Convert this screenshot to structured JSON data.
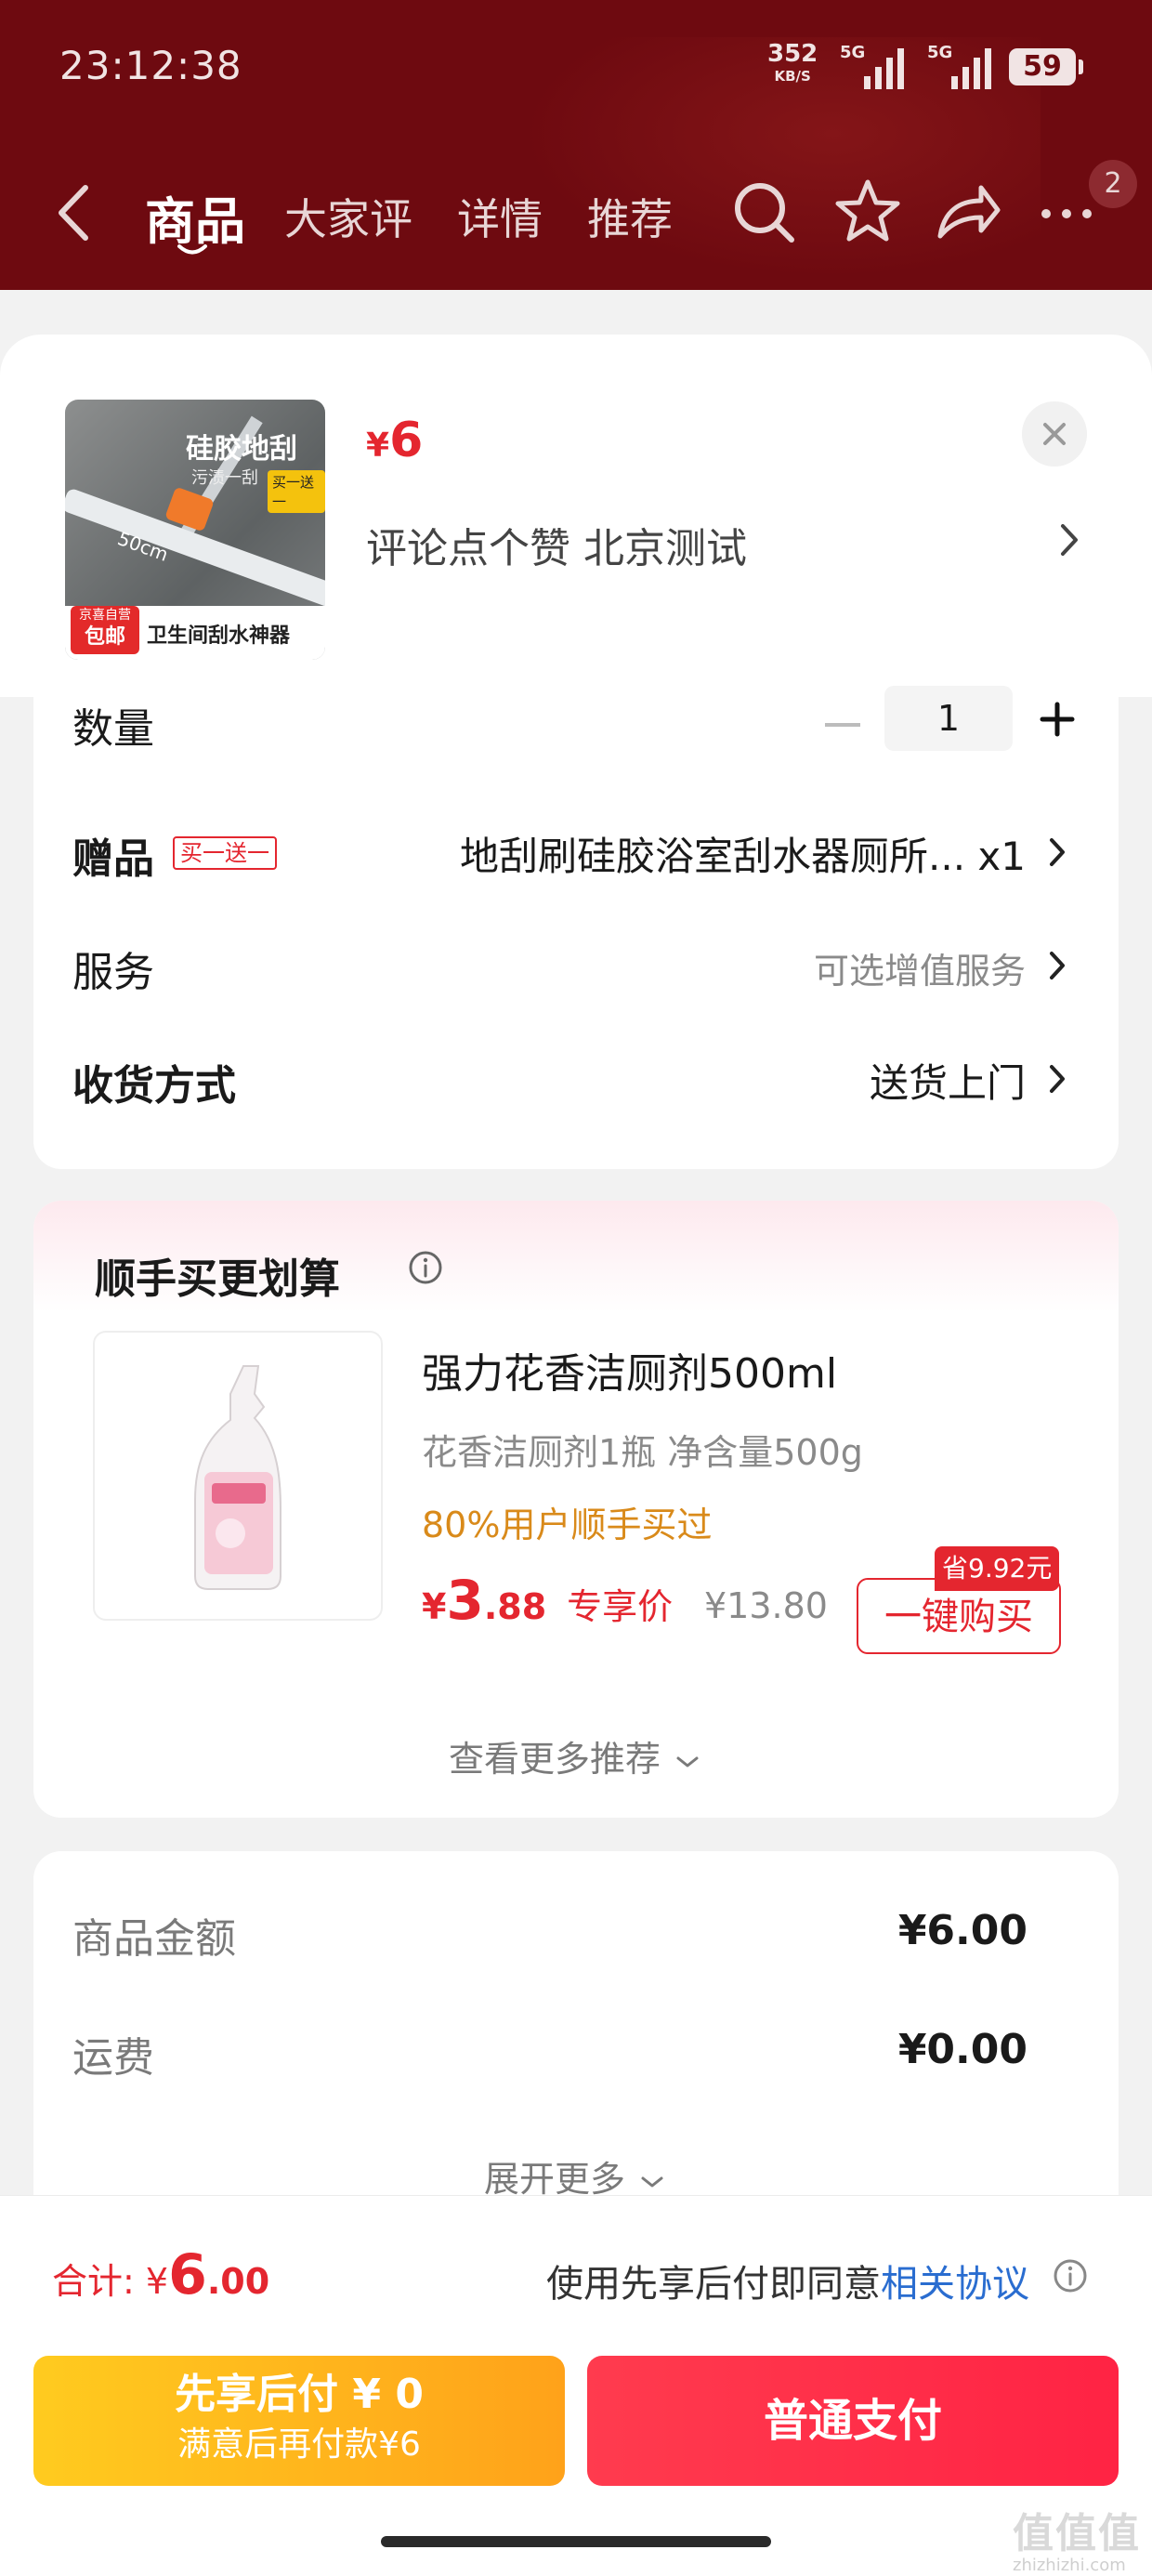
{
  "status_bar": {
    "time": "23:12:38",
    "net_speed": "352",
    "net_unit": "KB/S",
    "signal_1": "5G",
    "signal_2": "5G",
    "battery": "59"
  },
  "nav": {
    "tabs": [
      "商品",
      "大家评",
      "详情",
      "推荐"
    ],
    "badge": "2"
  },
  "product": {
    "price_symbol": "¥",
    "price": "6",
    "spec": "评论点个赞  北京测试",
    "thumb": {
      "title": "硅胶地刮",
      "sub": "污渍一刮",
      "promo": "买一送一",
      "size": "50cm",
      "badge_top": "京喜自营",
      "badge_bottom": "包邮",
      "caption": "卫生间刮水神器"
    }
  },
  "options": {
    "quantity_label": "数量",
    "quantity": "1",
    "gift_label": "赠品",
    "gift_tag": "买一送一",
    "gift_value": "地刮刷硅胶浴室刮水器厕所... x1",
    "service_label": "服务",
    "service_value": "可选增值服务",
    "delivery_label": "收货方式",
    "delivery_value": "送货上门"
  },
  "addon": {
    "title": "顺手买更划算",
    "name": "强力花香洁厕剂500ml",
    "spec": "花香洁厕剂1瓶   净含量500g",
    "buyers": "80%用户顺手买过",
    "price_symbol": "¥",
    "price_int": "3",
    "price_dec": ".88",
    "price_label": "专享价",
    "orig_price": "¥13.80",
    "save_tag": "省9.92元",
    "buy_label": "一键购买",
    "more_label": "查看更多推荐"
  },
  "summary": {
    "goods_label": "商品金额",
    "goods_value": "¥6.00",
    "shipping_label": "运费",
    "shipping_value": "¥0.00",
    "expand_label": "展开更多"
  },
  "bottom": {
    "total_label": "合计: ",
    "total_symbol": "¥",
    "total_int": "6",
    "total_dec": ".00",
    "agree_text": "使用先享后付即同意",
    "agree_link": "相关协议",
    "later_title": "先享后付 ¥ 0",
    "later_sub": "满意后再付款¥6",
    "pay_label": "普通支付"
  },
  "watermark": {
    "main": "值值值",
    "sub": "zhizhizhi.com"
  },
  "colors": {
    "header": "#6e0a10",
    "accent_red": "#e4262f",
    "link_blue": "#2a6dd0",
    "later_yellow": "#ffa21a",
    "buyers_orange": "#d98a1a"
  }
}
